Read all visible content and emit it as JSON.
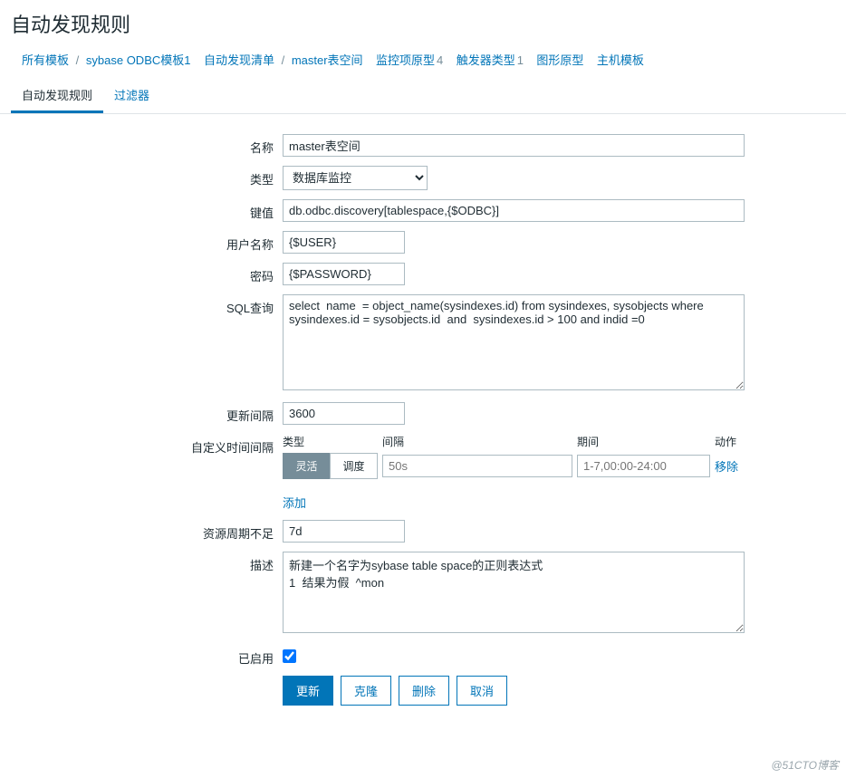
{
  "page_title": "自动发现规则",
  "breadcrumb": {
    "all_templates": "所有模板",
    "template": "sybase ODBC模板1",
    "discovery_list": "自动发现清单",
    "current": "master表空间",
    "items": [
      {
        "label": "监控项原型",
        "count": "4"
      },
      {
        "label": "触发器类型",
        "count": "1"
      },
      {
        "label": "图形原型",
        "count": ""
      },
      {
        "label": "主机模板",
        "count": ""
      }
    ]
  },
  "tabs": {
    "rule": "自动发现规则",
    "filter": "过滤器"
  },
  "labels": {
    "name": "名称",
    "type": "类型",
    "key": "键值",
    "user": "用户名称",
    "password": "密码",
    "sql": "SQL查询",
    "update_interval": "更新间隔",
    "custom_intervals": "自定义时间间隔",
    "keep_lost": "资源周期不足",
    "description": "描述",
    "enabled": "已启用"
  },
  "fields": {
    "name": "master表空间",
    "type": "数据库监控",
    "key": "db.odbc.discovery[tablespace,{$ODBC}]",
    "user": "{$USER}",
    "password": "{$PASSWORD}",
    "sql": "select  name  = object_name(sysindexes.id) from sysindexes, sysobjects where sysindexes.id = sysobjects.id  and  sysindexes.id > 100 and indid =0",
    "update_interval": "3600",
    "keep_lost": "7d",
    "description": "新建一个名字为sybase table space的正则表达式\n1  结果为假  ^mon",
    "enabled": true
  },
  "custom_intervals": {
    "headers": {
      "type": "类型",
      "interval": "间隔",
      "period": "期间",
      "action": "动作"
    },
    "seg_flexible": "灵活",
    "seg_scheduling": "调度",
    "row": {
      "delay_placeholder": "50s",
      "period_placeholder": "1-7,00:00-24:00"
    },
    "remove": "移除",
    "add": "添加"
  },
  "buttons": {
    "update": "更新",
    "clone": "克隆",
    "delete": "删除",
    "cancel": "取消"
  },
  "watermark": "@51CTO博客"
}
